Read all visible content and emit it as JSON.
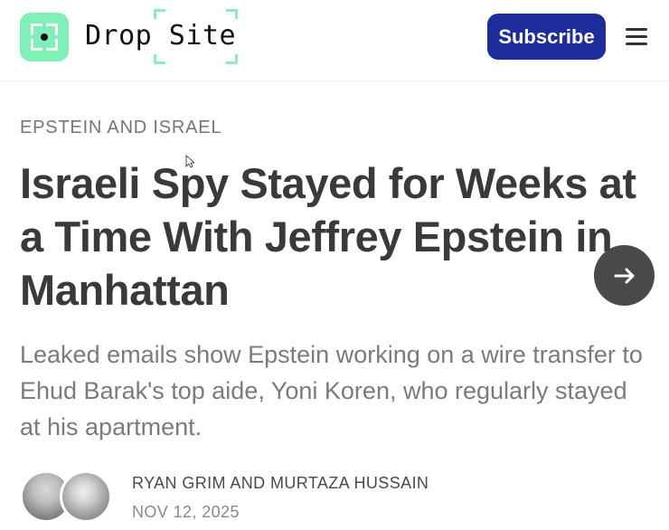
{
  "header": {
    "site_title": "Drop Site",
    "subscribe_label": "Subscribe",
    "logo_icon": "drop-site-logo-icon",
    "menu_icon": "menu-icon"
  },
  "article": {
    "kicker": "EPSTEIN AND ISRAEL",
    "headline": "Israeli Spy Stayed for Weeks at a Time With Jeffrey Epstein in Manhattan",
    "dek": "Leaked emails show Epstein working on a wire transfer to Ehud Barak's top aide, Yoni Koren, who regularly stayed at his apartment.",
    "authors": "RYAN GRIM AND MURTAZA HUSSAIN",
    "date": "NOV 12, 2025",
    "next_icon": "arrow-right-icon"
  },
  "colors": {
    "brand_green": "#7ff0b7",
    "subscribe_blue": "#1d2d9b",
    "headline": "#3a3a3a",
    "dek": "#7b7b7b"
  }
}
